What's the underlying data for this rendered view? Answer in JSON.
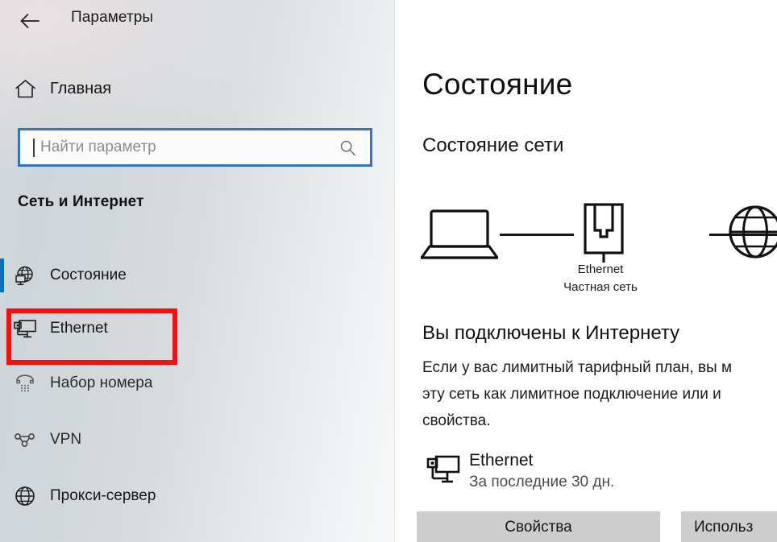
{
  "window": {
    "title": "Параметры",
    "back_icon": "back-arrow-icon"
  },
  "sidebar": {
    "home": {
      "label": "Главная",
      "icon": "home-icon"
    },
    "search": {
      "placeholder": "Найти параметр",
      "value": "",
      "icon": "search-icon"
    },
    "section_header": "Сеть и Интернет",
    "items": [
      {
        "label": "Состояние",
        "icon": "network-status-icon",
        "selected": true
      },
      {
        "label": "Ethernet",
        "icon": "ethernet-icon",
        "selected": false,
        "annotated": true
      },
      {
        "label": "Набор номера",
        "icon": "dialup-phone-icon",
        "selected": false
      },
      {
        "label": "VPN",
        "icon": "vpn-icon",
        "selected": false
      },
      {
        "label": "Прокси-сервер",
        "icon": "globe-icon",
        "selected": false
      }
    ]
  },
  "content": {
    "page_title": "Состояние",
    "subhead": "Состояние сети",
    "diagram": {
      "device_icon": "laptop-icon",
      "adapter_icon": "ethernet-adapter-icon",
      "internet_icon": "globe-icon",
      "adapter_label": "Ethernet",
      "adapter_sublabel": "Частная сеть"
    },
    "connected_title": "Вы подключены к Интернету",
    "connected_description": "Если у вас лимитный тарифный план, вы м\nэту сеть как лимитное подключение или и\nсвойства.",
    "ethernet_status": {
      "icon": "desktop-network-icon",
      "name": "Ethernet",
      "sub": "За последние 30 дн."
    },
    "buttons": {
      "properties": "Свойства",
      "usage": "Использ"
    }
  },
  "colors": {
    "accent": "#0b6ec6",
    "annotation": "#f90d0d",
    "search_focus_border": "#2f76c7",
    "button_face": "#cdcdcd"
  }
}
